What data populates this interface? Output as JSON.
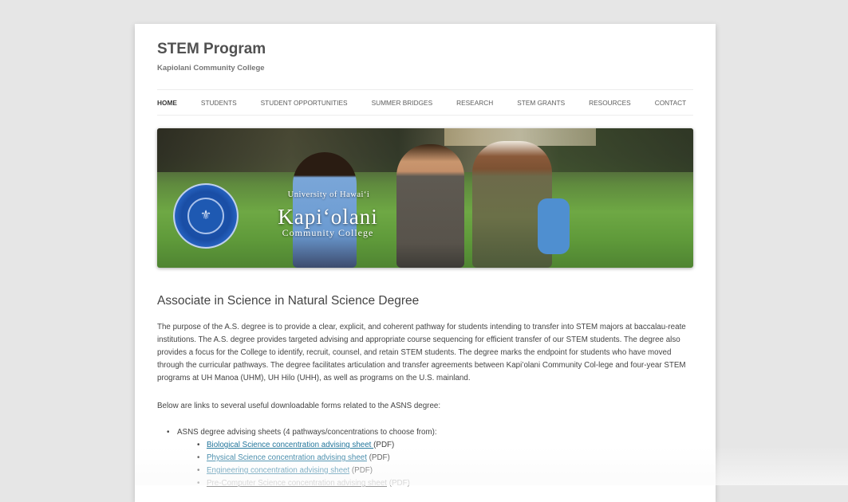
{
  "site": {
    "title": "STEM Program",
    "description": "Kapiolani Community College"
  },
  "nav": {
    "items": [
      {
        "label": "HOME",
        "current": true
      },
      {
        "label": "STUDENTS"
      },
      {
        "label": "STUDENT OPPORTUNITIES"
      },
      {
        "label": "SUMMER BRIDGES"
      },
      {
        "label": "RESEARCH"
      },
      {
        "label": "STEM GRANTS"
      },
      {
        "label": "RESOURCES"
      },
      {
        "label": "CONTACT"
      }
    ]
  },
  "banner": {
    "uh_text": "University of Hawai‘i",
    "college_name": "Kapi‘olani",
    "college_sub": "Community College"
  },
  "entry": {
    "title": "Associate in Science in Natural Science Degree",
    "paragraph1": "The purpose of the A.S. degree is to provide a clear, explicit, and coherent pathway for students intending to transfer into STEM majors at baccalau-reate institutions. The A.S. degree provides targeted advising and appropriate course sequencing for efficient transfer of our STEM students. The degree also provides a focus for the College to identify, recruit, counsel, and retain STEM students. The degree marks the endpoint for students who have moved through the curricular pathways. The degree facilitates articulation and transfer agreements between Kapi’olani Community Col-lege and four-year STEM programs at UH Manoa (UHM), UH Hilo (UHH), as well as programs on the U.S. mainland.",
    "paragraph2": "Below are links to several useful downloadable forms related to the ASNS degree:",
    "list_item": "ASNS degree advising sheets (4 pathways/concentrations to choose from):",
    "sheets": [
      {
        "link": "Biological Science concentration advising sheet ",
        "suffix": "(PDF)"
      },
      {
        "link": "Physical Science concentration advising sheet",
        "suffix": " (PDF)"
      },
      {
        "link": "Engineering concentration advising sheet",
        "suffix": " (PDF)"
      },
      {
        "link": "Pre-Computer Science concentration advising sheet",
        "suffix": " (PDF)"
      }
    ]
  },
  "colors": {
    "background": "#e6e6e6",
    "page": "#ffffff",
    "link": "#21759b",
    "text": "#444444"
  }
}
